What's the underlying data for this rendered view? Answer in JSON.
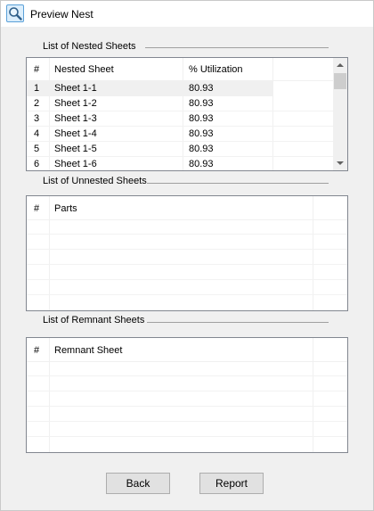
{
  "window": {
    "title": "Preview Nest",
    "icon": "magnifier-icon"
  },
  "nested": {
    "label": "List of Nested Sheets",
    "columns": [
      "#",
      "Nested Sheet",
      "% Utilization"
    ],
    "rows": [
      [
        "1",
        "Sheet 1-1",
        "80.93"
      ],
      [
        "2",
        "Sheet 1-2",
        "80.93"
      ],
      [
        "3",
        "Sheet 1-3",
        "80.93"
      ],
      [
        "4",
        "Sheet 1-4",
        "80.93"
      ],
      [
        "5",
        "Sheet 1-5",
        "80.93"
      ],
      [
        "6",
        "Sheet 1-6",
        "80.93"
      ]
    ]
  },
  "unnested": {
    "label": "List of Unnested Sheets",
    "columns": [
      "#",
      "Parts"
    ]
  },
  "remnant": {
    "label": "List of Remnant Sheets",
    "columns": [
      "#",
      "Remnant Sheet"
    ]
  },
  "buttons": {
    "back": "Back",
    "report": "Report"
  }
}
